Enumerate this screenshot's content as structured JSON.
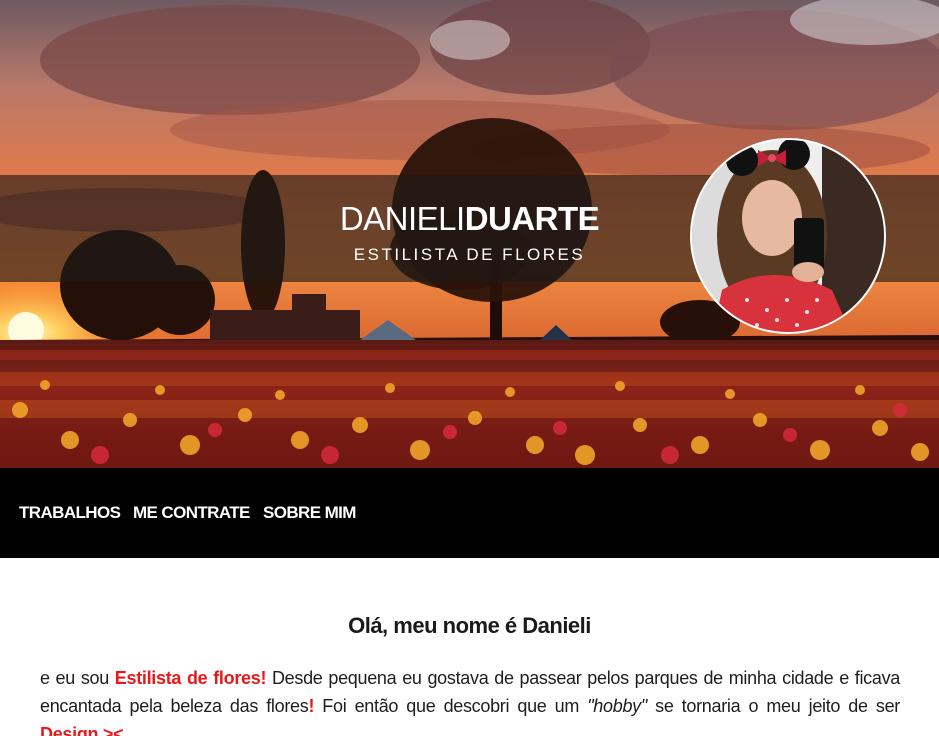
{
  "header": {
    "name_first": "DANIELI",
    "name_last": "DUARTE",
    "subtitle": "ESTILISTA DE FLORES"
  },
  "nav": {
    "items": [
      {
        "label": "TRABALHOS"
      },
      {
        "label": "ME CONTRATE"
      },
      {
        "label": "SOBRE MIM"
      }
    ]
  },
  "content": {
    "heading": "Olá, meu nome é Danieli",
    "p_text1": "e eu sou ",
    "p_highlight1": "Estilista de flores!",
    "p_text2": " Desde pequena eu gostava de passear pelos parques de minha cidade e ficava encantada pela beleza das flores",
    "p_highlight2": "!",
    "p_text3": " Foi então que descobri que um ",
    "p_italic": "\"hobby\"",
    "p_text4": " se tornaria o meu jeito de ser ",
    "p_highlight3": "Design ><"
  },
  "colors": {
    "accent": "#e8191c",
    "nav_bg": "#000000",
    "band_overlay": "rgba(30,26,24,0.62)"
  }
}
